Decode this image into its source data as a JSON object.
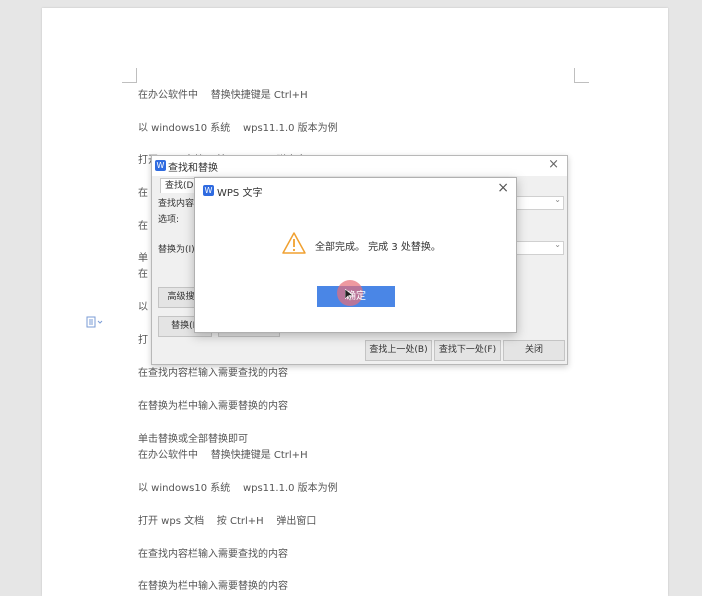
{
  "document": {
    "lines": [
      "在办公软件中    替换快捷键是 Ctrl+H",
      "以 windows10 系统    wps11.1.0 版本为例",
      "打开 wps 文档    按 Ctrl+H    弹出窗口",
      "在",
      "在",
      "单",
      "在",
      "以",
      "打",
      "在查找内容栏输入需要查找的内容",
      "在替换为栏中输入需要替换的内容",
      "单击替换或全部替换即可",
      "在办公软件中    替换快捷键是 Ctrl+H",
      "以 windows10 系统    wps11.1.0 版本为例",
      "打开 wps 文档    按 Ctrl+H    弹出窗口",
      "在查找内容栏输入需要查找的内容",
      "在替换为栏中输入需要替换的内容"
    ]
  },
  "find_replace": {
    "title": "查找和替换",
    "tab_find": "查找(D",
    "label_find": "查找内容",
    "label_options": "选项:",
    "label_replace": "替换为(I)",
    "btn_advanced": "高级搜",
    "btn_replace": "替换(R",
    "btn_prev": "查找上一处(B)",
    "btn_next": "查找下一处(F)",
    "btn_close": "关闭"
  },
  "message_box": {
    "title": "WPS 文字",
    "message": "全部完成。 完成 3 处替换。",
    "ok_label": "确定"
  },
  "colors": {
    "accent": "#4a86e6",
    "warning": "#f0a030"
  }
}
